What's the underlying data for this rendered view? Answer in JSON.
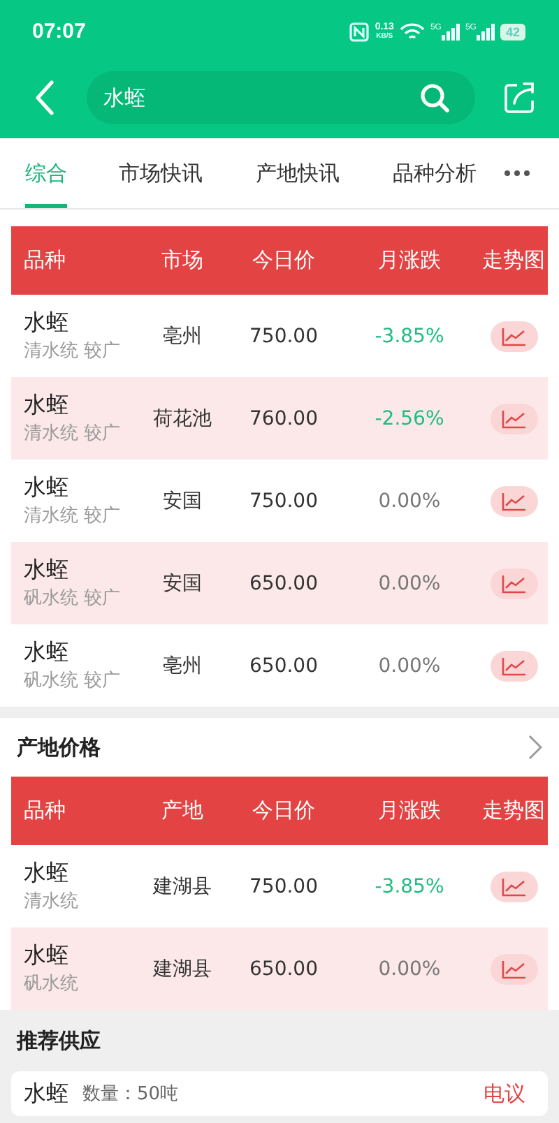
{
  "status_bar": {
    "time": "07:07",
    "speed": "0.13",
    "speed_unit": "KB/S",
    "signal_labels": [
      "5G",
      "5G"
    ],
    "battery": "42"
  },
  "search": {
    "value": "水蛭"
  },
  "tabs": [
    {
      "label": "综合",
      "selected": true
    },
    {
      "label": "市场快讯",
      "selected": false
    },
    {
      "label": "产地快讯",
      "selected": false
    },
    {
      "label": "品种分析",
      "selected": false
    }
  ],
  "market_table": {
    "columns": [
      "品种",
      "市场",
      "今日价",
      "月涨跌",
      "走势图"
    ],
    "rows": [
      {
        "name": "水蛭",
        "spec": "清水统 较广",
        "place": "亳州",
        "price": "750.00",
        "change": "-3.85%",
        "color": "#1fbd82"
      },
      {
        "name": "水蛭",
        "spec": "清水统 较广",
        "place": "荷花池",
        "price": "760.00",
        "change": "-2.56%",
        "color": "#1fbd82"
      },
      {
        "name": "水蛭",
        "spec": "清水统 较广",
        "place": "安国",
        "price": "750.00",
        "change": "0.00%",
        "color": "#777777"
      },
      {
        "name": "水蛭",
        "spec": "矾水统 较广",
        "place": "安国",
        "price": "650.00",
        "change": "0.00%",
        "color": "#777777"
      },
      {
        "name": "水蛭",
        "spec": "矾水统 较广",
        "place": "亳州",
        "price": "650.00",
        "change": "0.00%",
        "color": "#777777"
      }
    ]
  },
  "origin_section": {
    "title": "产地价格"
  },
  "origin_table": {
    "columns": [
      "品种",
      "产地",
      "今日价",
      "月涨跌",
      "走势图"
    ],
    "rows": [
      {
        "name": "水蛭",
        "spec": "清水统",
        "place": "建湖县",
        "price": "750.00",
        "change": "-3.85%",
        "color": "#1fbd82"
      },
      {
        "name": "水蛭",
        "spec": "矾水统",
        "place": "建湖县",
        "price": "650.00",
        "change": "0.00%",
        "color": "#777777"
      }
    ]
  },
  "supply_section": {
    "title": "推荐供应",
    "items": [
      {
        "name": "水蛭",
        "quantity": "数量：50吨",
        "price": "电议"
      }
    ]
  }
}
